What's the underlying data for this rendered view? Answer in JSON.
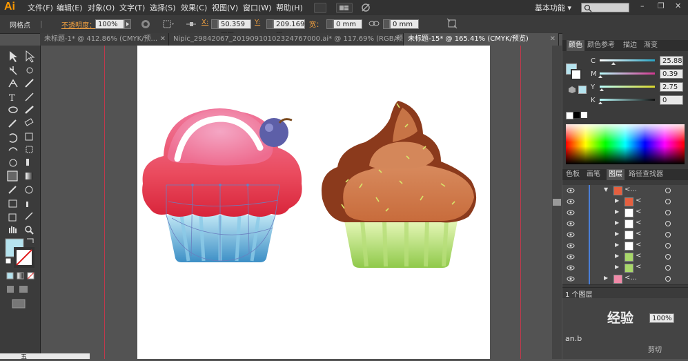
{
  "app": {
    "logo": "Ai"
  },
  "menu": [
    "文件(F)",
    "编辑(E)",
    "对象(O)",
    "文字(T)",
    "选择(S)",
    "效果(C)",
    "视图(V)",
    "窗口(W)",
    "帮助(H)"
  ],
  "workspace": {
    "label": "基本功能",
    "dropdown": "▾"
  },
  "window_controls": {
    "min": "–",
    "max": "❐",
    "close": "✕"
  },
  "control_bar": {
    "object_label": "网格点",
    "opacity_label": "不透明度：",
    "opacity_value": "100%",
    "x_label": "X:",
    "x_value": "50.359 mm",
    "y_label": "Y:",
    "y_value": "209.169 m",
    "w_label": "宽：",
    "w_value": "0 mm",
    "h_value": "0 mm"
  },
  "tabs": [
    {
      "label": "未标题-1* @ 412.86% (CMYK/预...",
      "close": "✕"
    },
    {
      "label": "Nipic_29842067_20190910102324767000.ai* @ 117.69% (RGB/预...",
      "close": "✕"
    },
    {
      "label": "未标题-15* @ 165.41% (CMYK/预览)",
      "close": "✕",
      "active": true
    }
  ],
  "color_panel": {
    "tabs": [
      "颜色",
      "颜色参考",
      "描边",
      "渐变"
    ],
    "channels": [
      {
        "label": "C",
        "value": "25.88",
        "color": "#29a3c2"
      },
      {
        "label": "M",
        "value": "0.39",
        "color": "#d1368f"
      },
      {
        "label": "Y",
        "value": "2.75",
        "color": "#d8d62a"
      },
      {
        "label": "K",
        "value": "0",
        "color": "#111111"
      }
    ]
  },
  "layers_panel": {
    "tabs": [
      "色板",
      "画笔",
      "图层",
      "路径查找器"
    ],
    "layer_count": "1 个图层",
    "rows": [
      {
        "name": "<...",
        "indent": 1
      },
      {
        "name": "<",
        "indent": 2
      },
      {
        "name": "<",
        "indent": 2
      },
      {
        "name": "<",
        "indent": 2
      },
      {
        "name": "<",
        "indent": 2
      },
      {
        "name": "<",
        "indent": 2
      },
      {
        "name": "<",
        "indent": 2
      },
      {
        "name": "<",
        "indent": 2
      },
      {
        "name": "<...",
        "indent": 1
      }
    ]
  },
  "bottom_panel": {
    "opacity_value": "100%",
    "watermark_site": "经验",
    "watermark_url": "an.b",
    "menu_item": "剪切"
  },
  "taskbar": {
    "ime": "五"
  },
  "colors": {
    "fill_swatch": "#b5e3ee",
    "cupcake_red": "#e83d4a",
    "cupcake_pink": "#f08aa8",
    "liner_blue": "#4b9ed0",
    "chocolate": "#8b3a1c",
    "liner_green": "#a8d76a"
  }
}
